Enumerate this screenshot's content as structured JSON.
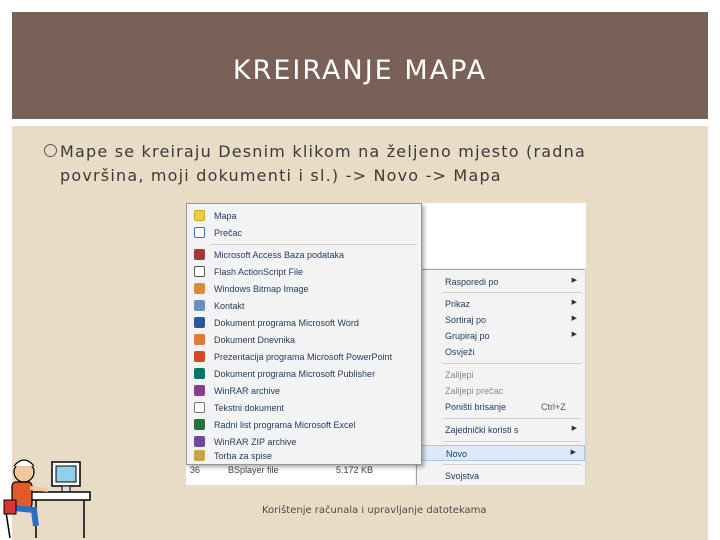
{
  "slide": {
    "title": "KREIRANJE MAPA",
    "bullet": "Mape se kreiraju Desnim klikom na željeno mjesto (radna površina, moji dokumenti i sl.) -> Novo -> Mapa",
    "caption": "Korištenje računala i upravljanje datotekama"
  },
  "context_menu": {
    "items": [
      {
        "label": "Rasporedi po",
        "submenu": true
      },
      {
        "label": "Prikaz",
        "submenu": true
      },
      {
        "label": "Sortiraj po",
        "submenu": true
      },
      {
        "label": "Grupiraj po",
        "submenu": true
      },
      {
        "label": "Osvježi"
      },
      {
        "label": "Zalijepi",
        "disabled": true
      },
      {
        "label": "Zalijepi prečac",
        "disabled": true
      },
      {
        "label": "Poništi brisanje",
        "shortcut": "Ctrl+Z"
      },
      {
        "label": "Zajednički koristi s",
        "submenu": true
      },
      {
        "label": "Novo",
        "submenu": true,
        "active": true
      },
      {
        "label": "Svojstva"
      }
    ]
  },
  "new_submenu": {
    "items": [
      {
        "label": "Mapa",
        "icon": "folder-icon"
      },
      {
        "label": "Prečac",
        "icon": "shortcut-icon"
      },
      {
        "label": "Microsoft Access Baza podataka",
        "icon": "access-icon"
      },
      {
        "label": "Flash ActionScript File",
        "icon": "flash-icon"
      },
      {
        "label": "Windows Bitmap Image",
        "icon": "bitmap-icon"
      },
      {
        "label": "Kontakt",
        "icon": "contact-icon"
      },
      {
        "label": "Dokument programa Microsoft Word",
        "icon": "word-icon"
      },
      {
        "label": "Dokument Dnevnika",
        "icon": "journal-icon"
      },
      {
        "label": "Prezentacija programa Microsoft PowerPoint",
        "icon": "powerpoint-icon"
      },
      {
        "label": "Dokument programa Microsoft Publisher",
        "icon": "publisher-icon"
      },
      {
        "label": "WinRAR archive",
        "icon": "winrar-icon"
      },
      {
        "label": "Tekstni dokument",
        "icon": "text-icon"
      },
      {
        "label": "Radni list programa Microsoft Excel",
        "icon": "excel-icon"
      },
      {
        "label": "WinRAR ZIP archive",
        "icon": "winrar-zip-icon"
      },
      {
        "label": "Torba za spise",
        "icon": "briefcase-icon"
      }
    ]
  },
  "background_row": {
    "num": "36",
    "name": "BSplayer file",
    "size": "5.172 KB"
  },
  "colors": {
    "title_bg": "#7a6157",
    "content_bg": "#e9dcc6",
    "menu_bg": "#f3f3f3",
    "highlight": "#dce9f7"
  }
}
